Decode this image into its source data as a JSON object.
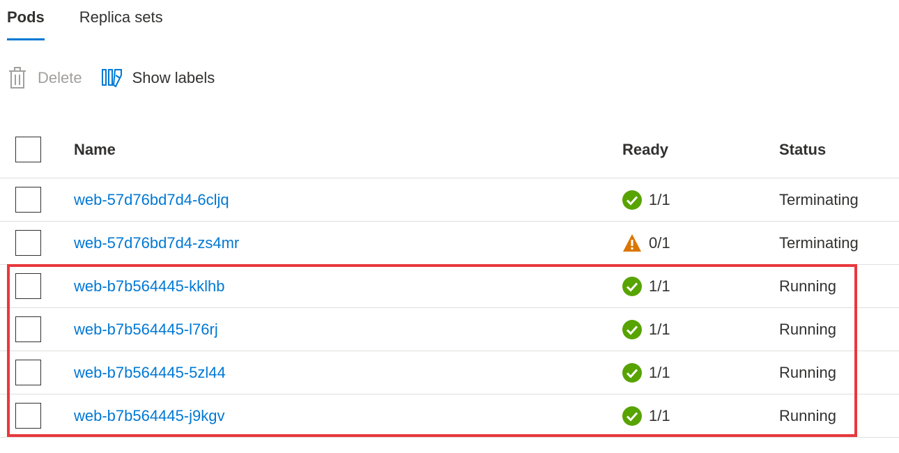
{
  "tabs": [
    {
      "label": "Pods",
      "selected": true
    },
    {
      "label": "Replica sets",
      "selected": false
    }
  ],
  "toolbar": {
    "delete_label": "Delete",
    "delete_icon": "trash-icon",
    "delete_disabled": true,
    "show_labels_label": "Show labels",
    "show_labels_icon": "tag-icon"
  },
  "table": {
    "columns": [
      "Name",
      "Ready",
      "Status"
    ],
    "rows": [
      {
        "name": "web-57d76bd7d4-6cljq",
        "ready": "1/1",
        "ready_state": "ok",
        "status": "Terminating"
      },
      {
        "name": "web-57d76bd7d4-zs4mr",
        "ready": "0/1",
        "ready_state": "warning",
        "status": "Terminating"
      },
      {
        "name": "web-b7b564445-kklhb",
        "ready": "1/1",
        "ready_state": "ok",
        "status": "Running"
      },
      {
        "name": "web-b7b564445-l76rj",
        "ready": "1/1",
        "ready_state": "ok",
        "status": "Running"
      },
      {
        "name": "web-b7b564445-5zl44",
        "ready": "1/1",
        "ready_state": "ok",
        "status": "Running"
      },
      {
        "name": "web-b7b564445-j9kgv",
        "ready": "1/1",
        "ready_state": "ok",
        "status": "Running"
      }
    ]
  },
  "colors": {
    "accent": "#0078d4",
    "ok": "#57a300",
    "warning": "#db7500",
    "highlight": "#e8383d"
  }
}
